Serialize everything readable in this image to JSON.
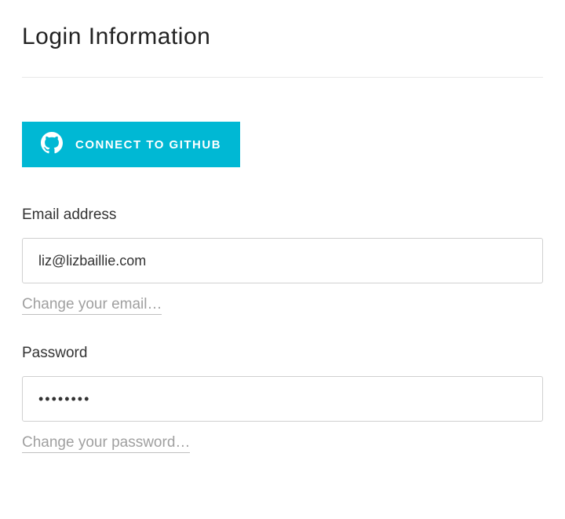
{
  "heading": "Login Information",
  "github_button_label": "CONNECT TO GITHUB",
  "email": {
    "label": "Email address",
    "value": "liz@lizbaillie.com",
    "change_link": "Change your email…"
  },
  "password": {
    "label": "Password",
    "value": "••••••••",
    "change_link": "Change your password…"
  }
}
